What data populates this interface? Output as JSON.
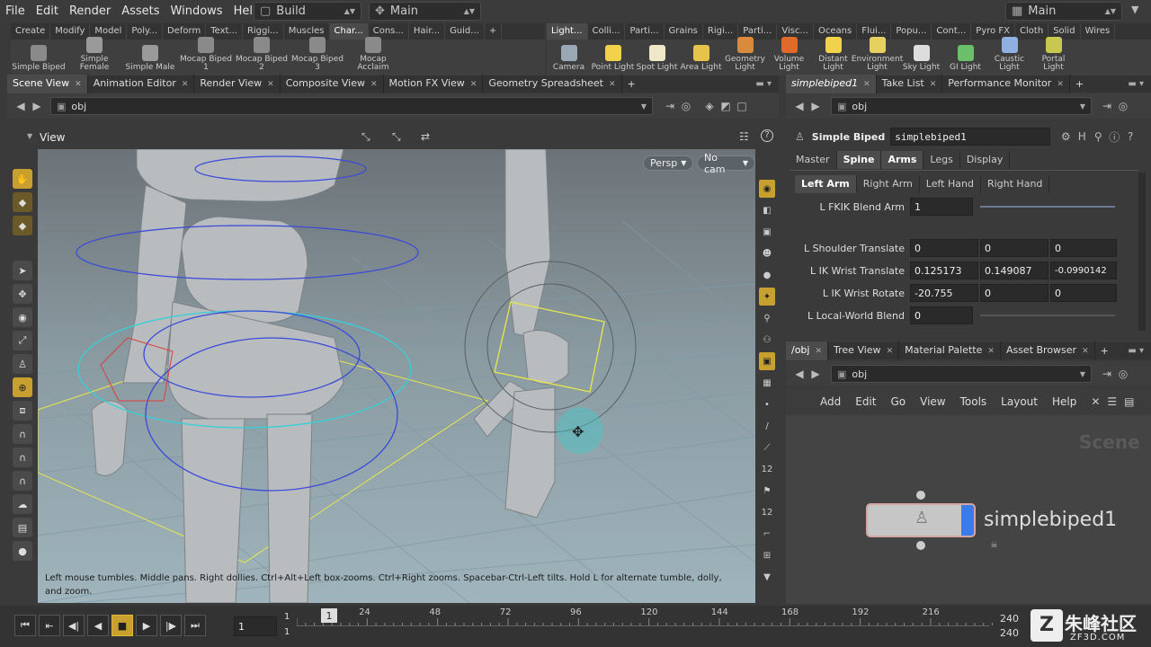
{
  "menu": [
    "File",
    "Edit",
    "Render",
    "Assets",
    "Windows",
    "Help"
  ],
  "desktop_build": "Build",
  "desktop_main": "Main",
  "desktop_main_right": "Main",
  "shelf_tabs_left": [
    "Create",
    "Modify",
    "Model",
    "Poly...",
    "Deform",
    "Text...",
    "Riggi...",
    "Muscles",
    "Char...",
    "Cons...",
    "Hair...",
    "Guid..."
  ],
  "shelf_tabs_right": [
    "Light...",
    "Colli...",
    "Parti...",
    "Grains",
    "Rigi...",
    "Parti...",
    "Visc...",
    "Oceans",
    "Flui...",
    "Popu...",
    "Cont...",
    "Pyro FX",
    "Cloth",
    "Solid",
    "Wires"
  ],
  "shelf_tools_left": [
    {
      "label": "Simple Biped",
      "color": "#8a8a8a"
    },
    {
      "label": "Simple Female",
      "color": "#9a9a9a"
    },
    {
      "label": "Simple Male",
      "color": "#9a9a9a"
    },
    {
      "label": "Mocap Biped 1",
      "color": "#8a8a8a"
    },
    {
      "label": "Mocap Biped 2",
      "color": "#8a8a8a"
    },
    {
      "label": "Mocap Biped 3",
      "color": "#8a8a8a"
    },
    {
      "label": "Mocap Acclaim",
      "color": "#8a8a8a"
    }
  ],
  "shelf_tools_right": [
    {
      "label": "Camera",
      "color": "#9aa7b5"
    },
    {
      "label": "Point Light",
      "color": "#f2d24a"
    },
    {
      "label": "Spot Light",
      "color": "#f0e7c8"
    },
    {
      "label": "Area Light",
      "color": "#e8c34a"
    },
    {
      "label": "Geometry Light",
      "color": "#d98a3a"
    },
    {
      "label": "Volume Light",
      "color": "#e06a2a"
    },
    {
      "label": "Distant Light",
      "color": "#f2d24a"
    },
    {
      "label": "Environment Light",
      "color": "#e8d060"
    },
    {
      "label": "Sky Light",
      "color": "#dddddd"
    },
    {
      "label": "GI Light",
      "color": "#6ac06a"
    },
    {
      "label": "Caustic Light",
      "color": "#8fb0e0"
    },
    {
      "label": "Portal Light",
      "color": "#c8c850"
    }
  ],
  "left_pane_tabs": [
    "Scene View",
    "Animation Editor",
    "Render View",
    "Composite View",
    "Motion FX View",
    "Geometry Spreadsheet"
  ],
  "right_pane_tabs": [
    "simplebiped1",
    "Take List",
    "Performance Monitor"
  ],
  "path_left": "obj",
  "path_right": "obj",
  "view_label": "View",
  "persp_label": "Persp",
  "cam_label": "No cam",
  "hint_text": "Left mouse tumbles. Middle pans. Right dollies. Ctrl+Alt+Left box-zooms. Ctrl+Right zooms. Spacebar-Ctrl-Left tilts. Hold L for alternate tumble, dolly, and zoom.",
  "params": {
    "node_type": "Simple Biped",
    "node_name": "simplebiped1",
    "tabs": [
      "Master",
      "Spine",
      "Arms",
      "Legs",
      "Display"
    ],
    "subtabs": [
      "Left Arm",
      "Right Arm",
      "Left Hand",
      "Right Hand"
    ],
    "rows": [
      {
        "label": "L FKIK Blend Arm",
        "values": [
          "1"
        ]
      },
      {
        "label": "L Shoulder Translate",
        "values": [
          "0",
          "0",
          "0"
        ]
      },
      {
        "label": "L IK Wrist Translate",
        "values": [
          "0.125173",
          "0.149087",
          "-0.0990142"
        ]
      },
      {
        "label": "L IK Wrist Rotate",
        "values": [
          "-20.755",
          "0",
          "0"
        ]
      },
      {
        "label": "L Local-World Blend",
        "values": [
          "0"
        ]
      }
    ]
  },
  "net_tabs": [
    "/obj",
    "Tree View",
    "Material Palette",
    "Asset Browser"
  ],
  "net_menu": [
    "Add",
    "Edit",
    "Go",
    "View",
    "Tools",
    "Layout",
    "Help"
  ],
  "net_context": "Scene",
  "net_node_name": "simplebiped1",
  "timeline": {
    "start": "1",
    "start2": "1",
    "current": "1",
    "current_field": "1",
    "end": "240",
    "end2": "240",
    "ticks": [
      "24",
      "48",
      "72",
      "96",
      "120",
      "144",
      "168",
      "192",
      "216"
    ]
  },
  "watermark": "朱峰社区",
  "watermark_url": "ZF3D.COM"
}
